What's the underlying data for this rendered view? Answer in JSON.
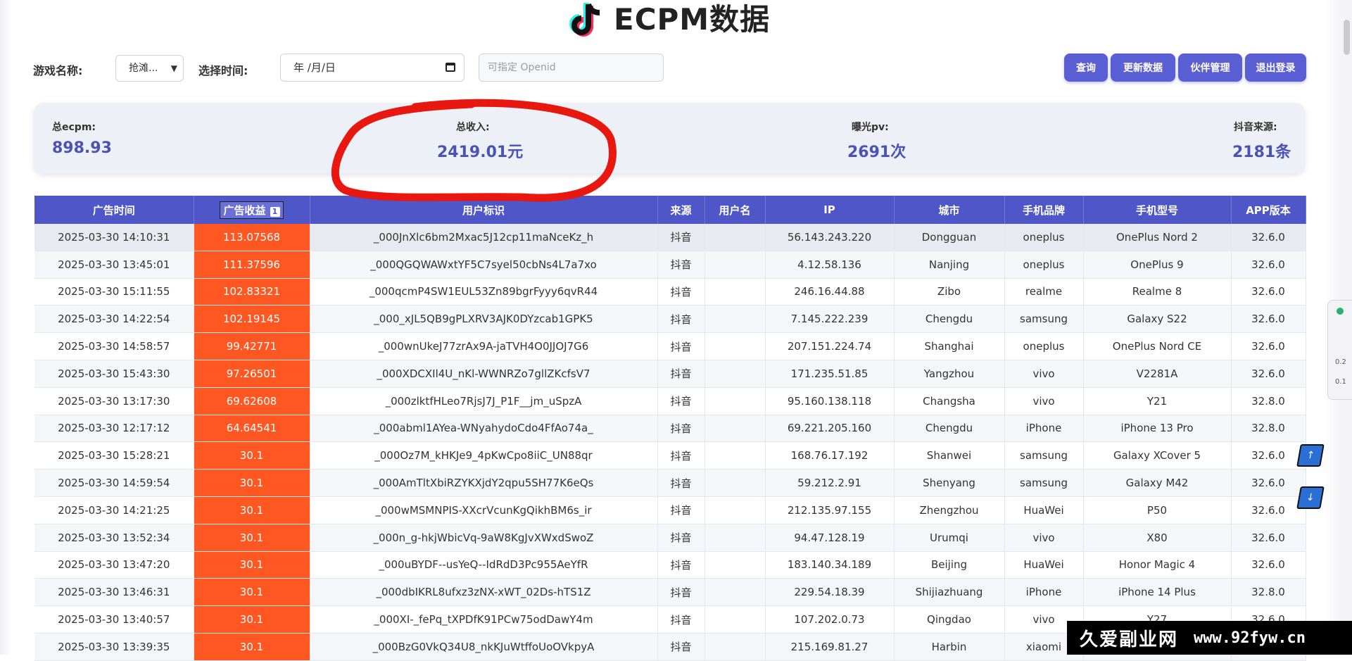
{
  "header": {
    "title": "ECPM数据",
    "logo_icon": "tiktok-logo-icon"
  },
  "filters": {
    "game_label": "游戏名称:",
    "game_selected": "抢滩...",
    "time_label": "选择时间:",
    "date_value": "年 /月/日",
    "openid_placeholder": "可指定 Openid"
  },
  "buttons": {
    "query": "查询",
    "refresh": "更新数据",
    "partners": "伙伴管理",
    "logout": "退出登录",
    "color": "#5a5fd3"
  },
  "stats": {
    "ecpm_label": "总ecpm:",
    "ecpm_value": "898.93",
    "revenue_label": "总收入:",
    "revenue_value": "2419.01元",
    "pv_label": "曝光pv:",
    "pv_value": "2691次",
    "source_label": "抖音来源:",
    "source_value": "2181条"
  },
  "table": {
    "columns": [
      "广告时间",
      "广告收益",
      "用户标识",
      "来源",
      "用户名",
      "IP",
      "城市",
      "手机品牌",
      "手机型号",
      "APP版本"
    ],
    "sort_badge": "1",
    "revenue_color": "#ff5722",
    "header_color": "#4e56c8",
    "rows": [
      [
        "2025-03-30 14:10:31",
        "113.07568",
        "_000JnXlc6bm2Mxac5J12cp11maNceKz_h",
        "抖音",
        "",
        "56.143.243.220",
        "Dongguan",
        "oneplus",
        "OnePlus Nord 2",
        "32.6.0"
      ],
      [
        "2025-03-30 13:45:01",
        "111.37596",
        "_000QGQWAWxtYF5C7syel50cbNs4L7a7xo",
        "抖音",
        "",
        "4.12.58.136",
        "Nanjing",
        "oneplus",
        "OnePlus 9",
        "32.6.0"
      ],
      [
        "2025-03-30 15:11:55",
        "102.83321",
        "_000qcmP4SW1EUL53Zn89bgrFyyy6qvR44",
        "抖音",
        "",
        "246.16.44.88",
        "Zibo",
        "realme",
        "Realme 8",
        "32.6.0"
      ],
      [
        "2025-03-30 14:22:54",
        "102.19145",
        "_000_xJL5QB9gPLXRV3AJK0DYzcab1GPK5",
        "抖音",
        "",
        "7.145.222.239",
        "Chengdu",
        "samsung",
        "Galaxy S22",
        "32.6.0"
      ],
      [
        "2025-03-30 14:58:57",
        "99.42771",
        "_000wnUkeJ77zrAx9A-jaTVH4O0JJOJ7G6",
        "抖音",
        "",
        "207.151.224.74",
        "Shanghai",
        "oneplus",
        "OnePlus Nord CE",
        "32.6.0"
      ],
      [
        "2025-03-30 15:43:30",
        "97.26501",
        "_000XDCXIl4U_nKl-WWNRZo7gllZKcfsV7",
        "抖音",
        "",
        "171.235.51.85",
        "Yangzhou",
        "vivo",
        "V2281A",
        "32.6.0"
      ],
      [
        "2025-03-30 13:17:30",
        "69.62608",
        "_000zlktfHLeo7RjsJ7J_P1F__jm_uSpzA",
        "抖音",
        "",
        "95.160.138.118",
        "Changsha",
        "vivo",
        "Y21",
        "32.8.0"
      ],
      [
        "2025-03-30 12:17:12",
        "64.64541",
        "_000abml1AYea-WNyahydoCdo4FfAo74a_",
        "抖音",
        "",
        "69.221.205.160",
        "Chengdu",
        "iPhone",
        "iPhone 13 Pro",
        "32.8.0"
      ],
      [
        "2025-03-30 15:28:21",
        "30.1",
        "_000Oz7M_kHKJe9_4pKwCpo8iiC_UN88qr",
        "抖音",
        "",
        "168.76.17.192",
        "Shanwei",
        "samsung",
        "Galaxy XCover 5",
        "32.6.0"
      ],
      [
        "2025-03-30 14:59:54",
        "30.1",
        "_000AmTltXbiRZYKXjdY2qpu5SH77K6eQs",
        "抖音",
        "",
        "59.212.2.91",
        "Shenyang",
        "samsung",
        "Galaxy M42",
        "32.6.0"
      ],
      [
        "2025-03-30 14:21:25",
        "30.1",
        "_000wMSMNPIS-XXcrVcunKgQikhBM6s_ir",
        "抖音",
        "",
        "212.135.97.155",
        "Zhengzhou",
        "HuaWei",
        "P50",
        "32.6.0"
      ],
      [
        "2025-03-30 13:52:34",
        "30.1",
        "_000n_g-hkjWbicVq-9aW8KgJvXWxdSwoZ",
        "抖音",
        "",
        "94.47.128.19",
        "Urumqi",
        "vivo",
        "X80",
        "32.6.0"
      ],
      [
        "2025-03-30 13:47:20",
        "30.1",
        "_000uBYDF--usYeQ--IdRdD3Pc955AeYfR",
        "抖音",
        "",
        "183.140.34.189",
        "Beijing",
        "HuaWei",
        "Honor Magic 4",
        "32.6.0"
      ],
      [
        "2025-03-30 13:46:31",
        "30.1",
        "_000dbIKRL8ufxz3zNX-xWT_02Ds-hTS1Z",
        "抖音",
        "",
        "229.54.18.39",
        "Shijiazhuang",
        "iPhone",
        "iPhone 14 Plus",
        "32.8.0"
      ],
      [
        "2025-03-30 13:40:57",
        "30.1",
        "_000XI-_fePq_tXPDfK91PCw75odDawY4m",
        "抖音",
        "",
        "107.202.0.73",
        "Qingdao",
        "vivo",
        "Y27",
        "32.6.0"
      ],
      [
        "2025-03-30 13:39:35",
        "30.1",
        "_000BzG0VkQ34U8_nkKJuWtffoUoOVkpyA",
        "抖音",
        "",
        "215.169.81.27",
        "Harbin",
        "xiaomi",
        "",
        ""
      ]
    ]
  },
  "side_widget": {
    "line1": "0.2",
    "line2": "0.1"
  },
  "watermark": {
    "cn": "久爱副业网",
    "url": "www.92fyw.cn"
  }
}
